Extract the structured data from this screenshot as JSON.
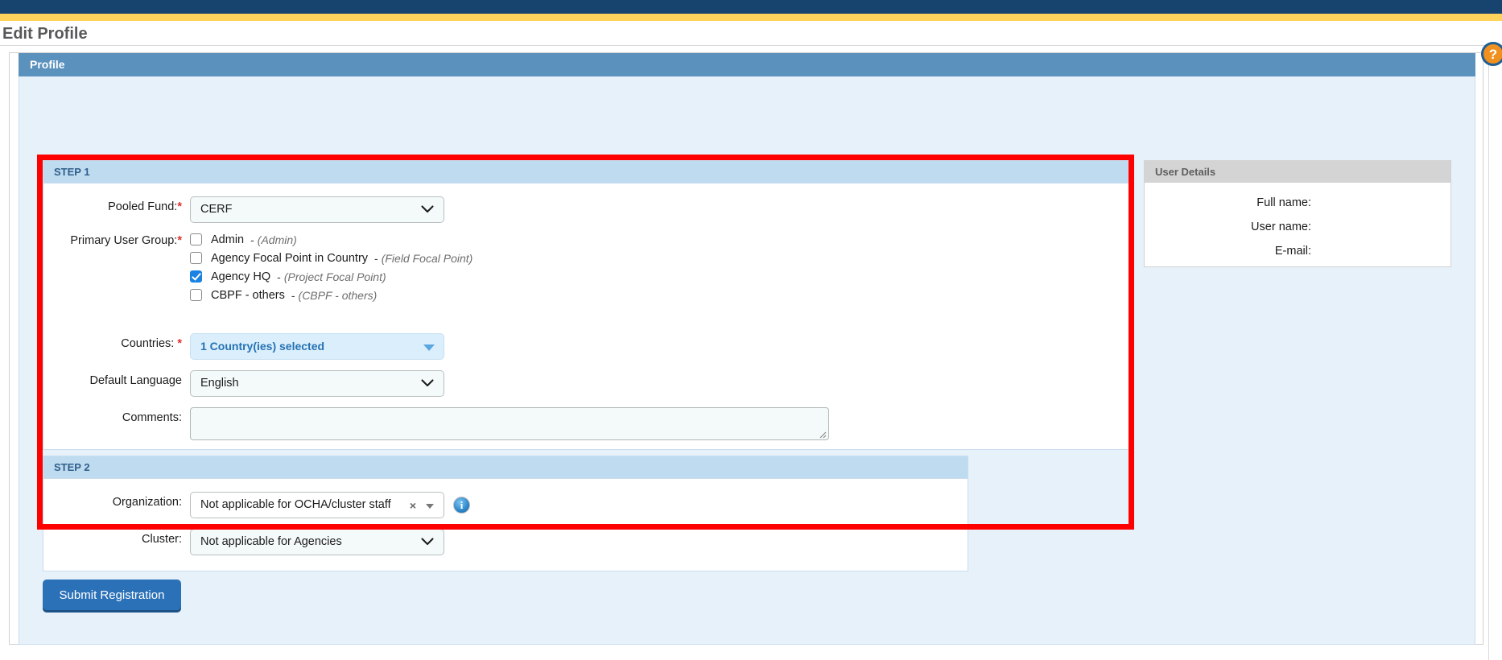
{
  "theme": {
    "navy": "#17446e",
    "gold": "#fdd35c",
    "panel_blue": "#5b91bd",
    "step_header_blue": "#bfdbf0",
    "highlight_red": "#ff0000",
    "accent_button": "#2b71b8",
    "checkbox_checked": "#1a82e2"
  },
  "page": {
    "title": "Edit Profile"
  },
  "profile_card": {
    "header": "Profile"
  },
  "step1": {
    "header": "STEP 1",
    "pooled_fund": {
      "label": "Pooled Fund:",
      "required_mark": "*",
      "value": "CERF",
      "icon": "chevron-down-icon"
    },
    "primary_user_group": {
      "label": "Primary User Group:",
      "required_mark": "*",
      "options": [
        {
          "name": "Admin",
          "separator": "-",
          "role": "(Admin)",
          "checked": false
        },
        {
          "name": "Agency Focal Point in Country",
          "separator": "-",
          "role": "(Field Focal Point)",
          "checked": false
        },
        {
          "name": "Agency HQ",
          "separator": "-",
          "role": "(Project Focal Point)",
          "checked": true
        },
        {
          "name": "CBPF - others",
          "separator": "-",
          "role": "(CBPF - others)",
          "checked": false
        }
      ]
    },
    "countries": {
      "label": "Countries:",
      "required_mark": "*",
      "value": "1 Country(ies) selected",
      "icon": "caret-down-icon"
    },
    "default_language": {
      "label": "Default Language",
      "value": "English",
      "icon": "chevron-down-icon"
    },
    "comments": {
      "label": "Comments:",
      "value": "",
      "placeholder": "",
      "resize_icon": "resize-grip-icon"
    }
  },
  "step2": {
    "header": "STEP 2",
    "organization": {
      "label": "Organization:",
      "value": "Not applicable for OCHA/cluster staff",
      "clear_icon": "×",
      "caret_icon": "caret-down-icon",
      "info_icon": "i",
      "info_icon_name": "info-icon"
    },
    "cluster": {
      "label": "Cluster:",
      "value": "Not applicable for Agencies",
      "icon": "chevron-down-icon"
    }
  },
  "submit": {
    "label": "Submit Registration"
  },
  "user_details": {
    "header": "User Details",
    "rows": [
      {
        "label": "Full name:",
        "value": ""
      },
      {
        "label": "User name:",
        "value": ""
      },
      {
        "label": "E-mail:",
        "value": ""
      }
    ]
  },
  "help": {
    "glyph": "?",
    "name": "help-icon"
  }
}
